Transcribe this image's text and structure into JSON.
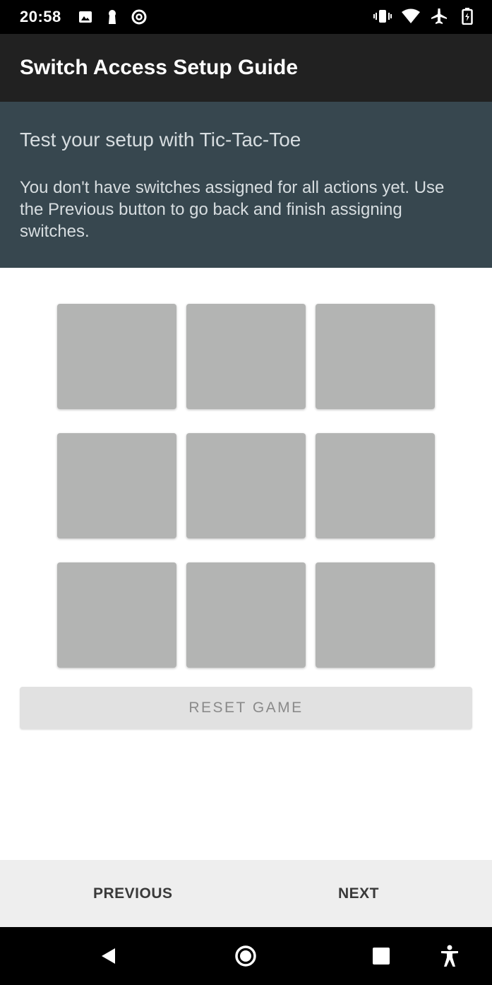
{
  "status_bar": {
    "time": "20:58",
    "left_icons": [
      "image-icon",
      "keyhole-icon",
      "sync-icon"
    ],
    "right_icons": [
      "vibrate-icon",
      "wifi-icon",
      "airplane-icon",
      "battery-icon"
    ]
  },
  "app_bar": {
    "title": "Switch Access Setup Guide"
  },
  "info": {
    "heading": "Test your setup with Tic-Tac-Toe",
    "body": "You don't have switches assigned for all actions yet. Use the Previous button to go back and finish assigning switches."
  },
  "game": {
    "cells": [
      "",
      "",
      "",
      "",
      "",
      "",
      "",
      "",
      ""
    ],
    "reset_label": "RESET GAME"
  },
  "navigation": {
    "previous_label": "PREVIOUS",
    "next_label": "NEXT"
  },
  "system_nav": {
    "buttons": [
      "back-icon",
      "home-icon",
      "recents-icon",
      "accessibility-icon"
    ]
  },
  "colors": {
    "app_bar": "#212121",
    "info_panel": "#37474f",
    "cell": "#b3b4b3",
    "reset_button": "#e1e1e1",
    "bottom_nav": "#eeeeee"
  }
}
